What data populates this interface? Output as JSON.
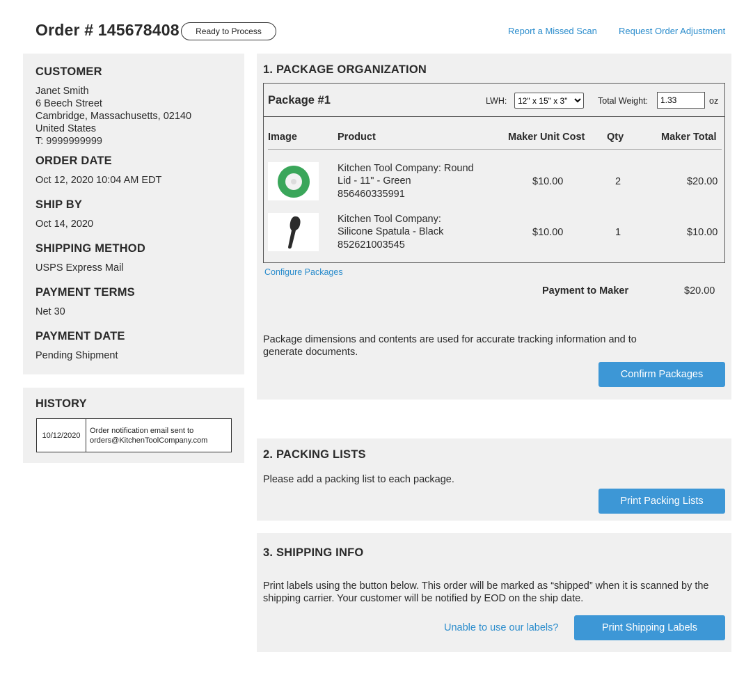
{
  "header": {
    "order_title": "Order # 145678408",
    "status": "Ready to Process",
    "report_link": "Report a Missed Scan",
    "adjust_link": "Request Order Adjustment"
  },
  "info": {
    "customer_heading": "CUSTOMER",
    "customer_name": "Janet Smith",
    "customer_street": "6 Beech Street",
    "customer_city": "Cambridge, Massachusetts, 02140",
    "customer_country": "United States",
    "customer_phone": "T: 9999999999",
    "order_date_heading": "ORDER DATE",
    "order_date": "Oct 12, 2020 10:04 AM EDT",
    "ship_by_heading": "SHIP BY",
    "ship_by": "Oct 14, 2020",
    "shipping_method_heading": "SHIPPING METHOD",
    "shipping_method": "USPS Express Mail",
    "payment_terms_heading": "PAYMENT TERMS",
    "payment_terms": "Net 30",
    "payment_date_heading": "PAYMENT DATE",
    "payment_date": "Pending Shipment"
  },
  "history": {
    "heading": "HISTORY",
    "entries": [
      {
        "date": "10/12/2020",
        "line1": "Order notification email sent to",
        "line2": "orders@KitchenToolCompany.com"
      }
    ]
  },
  "package_section": {
    "title": "1. PACKAGE ORGANIZATION",
    "package_name": "Package #1",
    "lwh_label": "LWH:",
    "lwh_value": "12\" x 15\" x 3\"",
    "weight_label": "Total Weight:",
    "weight_value": "1.33",
    "weight_unit": "oz",
    "columns": [
      "Image",
      "Product",
      "Maker Unit Cost",
      "Qty",
      "Maker Total"
    ],
    "items": [
      {
        "name_line1": "Kitchen Tool Company: Round",
        "name_line2": "Lid - 11\" - Green",
        "sku": "856460335991",
        "unit_cost": "$10.00",
        "qty": "2",
        "total": "$20.00",
        "icon": "round-lid-icon"
      },
      {
        "name_line1": "Kitchen Tool Company:",
        "name_line2": "Silicone Spatula - Black",
        "sku": "852621003545",
        "unit_cost": "$10.00",
        "qty": "1",
        "total": "$10.00",
        "icon": "spatula-icon"
      }
    ],
    "configure_link": "Configure Packages",
    "payment_label": "Payment to Maker",
    "payment_value": "$20.00",
    "note_line1": "Package dimensions and contents are used for accurate tracking information and to",
    "note_line2": "generate documents.",
    "confirm_button": "Confirm Packages"
  },
  "packing_section": {
    "title": "2. PACKING LISTS",
    "text": "Please add a packing list to each package.",
    "button": "Print Packing Lists"
  },
  "shipping_section": {
    "title": "3. SHIPPING INFO",
    "text_line1": "Print labels using the button below. This order will be marked as “shipped” when it is scanned by the",
    "text_line2": "shipping carrier. Your customer will be notified by EOD on the ship date.",
    "unable_link": "Unable to use our labels?",
    "button": "Print Shipping Labels"
  },
  "colors": {
    "accent": "#3d97d6",
    "link": "#2a8ccc",
    "panel": "#f0f0f0",
    "lid_green": "#3aa65a"
  }
}
